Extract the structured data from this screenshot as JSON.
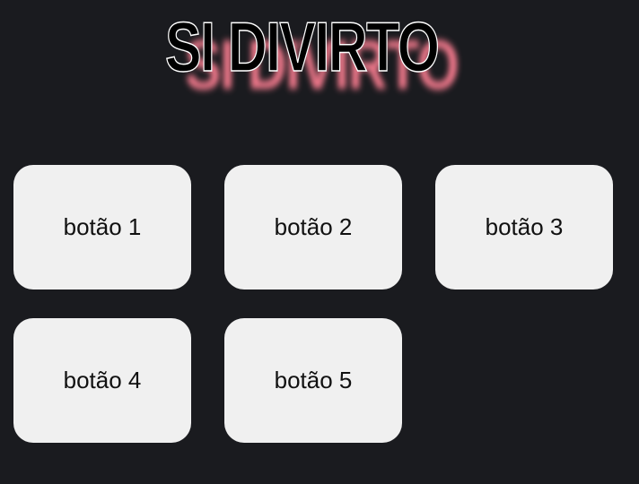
{
  "page": {
    "title": "SI DIVIRTO",
    "background_color": "#1a1b1f",
    "title_shadow_color": "#ff7f93"
  },
  "buttons": [
    {
      "label": "botão 1"
    },
    {
      "label": "botão 2"
    },
    {
      "label": "botão 3"
    },
    {
      "label": "botão 4"
    },
    {
      "label": "botão 5"
    }
  ]
}
